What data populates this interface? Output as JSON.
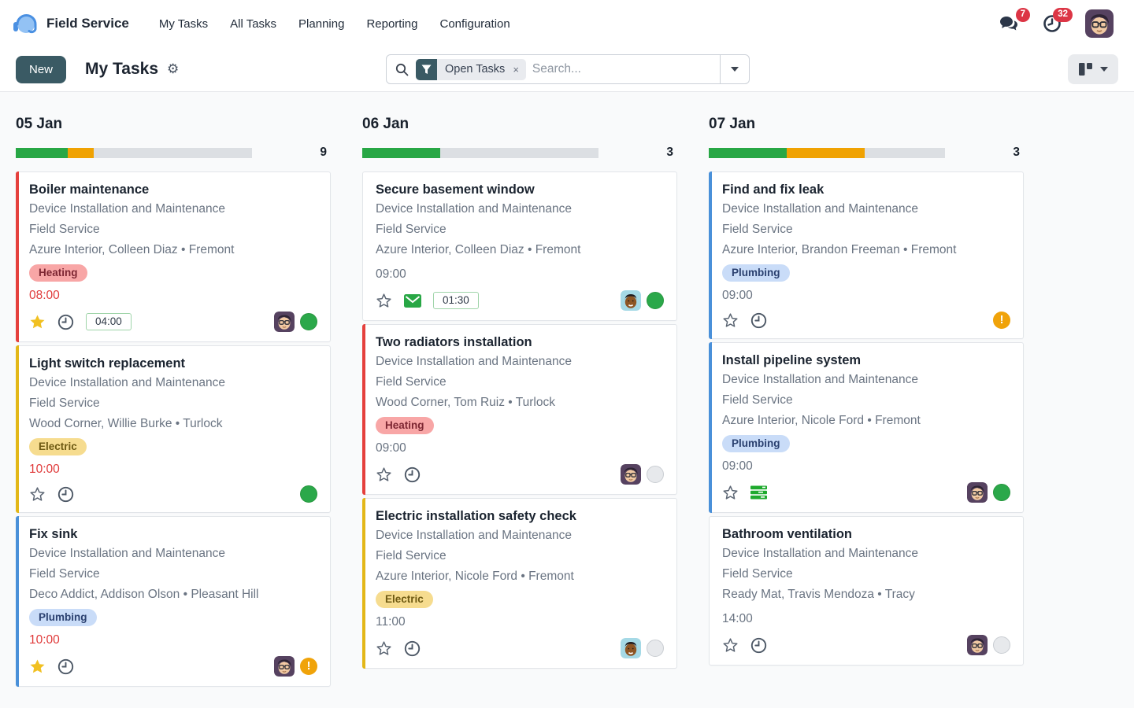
{
  "nav": {
    "app_name": "Field Service",
    "items": [
      "My Tasks",
      "All Tasks",
      "Planning",
      "Reporting",
      "Configuration"
    ],
    "messages_badge": "7",
    "activities_badge": "32"
  },
  "control": {
    "new_button": "New",
    "title": "My Tasks",
    "filter_facet": "Open Tasks",
    "facet_remove": "×",
    "search_placeholder": "Search..."
  },
  "colors": {
    "primary": "#3a5a64",
    "success": "#28a745",
    "warning": "#f0a202",
    "danger": "#dc3545",
    "stripe_red": "#e5403d",
    "stripe_yellow": "#e3b718",
    "stripe_blue": "#4a90d9"
  },
  "board": {
    "columns": [
      {
        "date": "05 Jan",
        "count": "9",
        "progress": {
          "green_pct": 22,
          "orange_pct": 11
        },
        "cards": [
          {
            "title": "Boiler maintenance",
            "project": "Device Installation and Maintenance",
            "subproject": "Field Service",
            "customer": "Azure Interior, Colleen Diaz • Fremont",
            "tag": {
              "label": "Heating",
              "color": "red"
            },
            "time": "08:00",
            "overdue": true,
            "stripe": "red",
            "star": "filled",
            "icon": "clock",
            "timer": "04:00",
            "avatar": "glasses",
            "status": "green"
          },
          {
            "title": "Light switch replacement",
            "project": "Device Installation and Maintenance",
            "subproject": "Field Service",
            "customer": "Wood Corner, Willie Burke • Turlock",
            "tag": {
              "label": "Electric",
              "color": "yellow"
            },
            "time": "10:00",
            "overdue": true,
            "stripe": "yellow",
            "star": "outline",
            "icon": "clock",
            "timer": null,
            "avatar": null,
            "status": "green"
          },
          {
            "title": "Fix sink",
            "project": "Device Installation and Maintenance",
            "subproject": "Field Service",
            "customer": "Deco Addict, Addison Olson • Pleasant Hill",
            "tag": {
              "label": "Plumbing",
              "color": "blue"
            },
            "time": "10:00",
            "overdue": true,
            "stripe": "blue",
            "star": "filled",
            "icon": "clock",
            "timer": null,
            "avatar": "glasses",
            "status": "warning"
          }
        ]
      },
      {
        "date": "06 Jan",
        "count": "3",
        "progress": {
          "green_pct": 33,
          "orange_pct": 0
        },
        "cards": [
          {
            "title": "Secure basement window",
            "project": "Device Installation and Maintenance",
            "subproject": "Field Service",
            "customer": "Azure Interior, Colleen Diaz • Fremont",
            "tag": null,
            "time": "09:00",
            "overdue": false,
            "stripe": null,
            "star": "outline",
            "icon": "envelope",
            "timer": "01:30",
            "avatar": "dark",
            "status": "green"
          },
          {
            "title": "Two radiators installation",
            "project": "Device Installation and Maintenance",
            "subproject": "Field Service",
            "customer": "Wood Corner, Tom Ruiz • Turlock",
            "tag": {
              "label": "Heating",
              "color": "red"
            },
            "time": "09:00",
            "overdue": false,
            "stripe": "red",
            "star": "outline",
            "icon": "clock",
            "timer": null,
            "avatar": "glasses",
            "status": "gray"
          },
          {
            "title": "Electric installation safety check",
            "project": "Device Installation and Maintenance",
            "subproject": "Field Service",
            "customer": "Azure Interior, Nicole Ford • Fremont",
            "tag": {
              "label": "Electric",
              "color": "yellow"
            },
            "time": "11:00",
            "overdue": false,
            "stripe": "yellow",
            "star": "outline",
            "icon": "clock",
            "timer": null,
            "avatar": "dark",
            "status": "gray"
          }
        ]
      },
      {
        "date": "07 Jan",
        "count": "3",
        "progress": {
          "green_pct": 33,
          "orange_pct": 33
        },
        "cards": [
          {
            "title": "Find and fix leak",
            "project": "Device Installation and Maintenance",
            "subproject": "Field Service",
            "customer": "Azure Interior, Brandon Freeman • Fremont",
            "tag": {
              "label": "Plumbing",
              "color": "blue"
            },
            "time": "09:00",
            "overdue": false,
            "stripe": "blue",
            "star": "outline",
            "icon": "clock",
            "timer": null,
            "avatar": null,
            "status": "warning"
          },
          {
            "title": "Install pipeline system",
            "project": "Device Installation and Maintenance",
            "subproject": "Field Service",
            "customer": "Azure Interior, Nicole Ford • Fremont",
            "tag": {
              "label": "Plumbing",
              "color": "blue"
            },
            "time": "09:00",
            "overdue": false,
            "stripe": "blue",
            "star": "outline",
            "icon": "bars",
            "timer": null,
            "avatar": "glasses",
            "status": "green"
          },
          {
            "title": "Bathroom ventilation",
            "project": "Device Installation and Maintenance",
            "subproject": "Field Service",
            "customer": "Ready Mat, Travis Mendoza • Tracy",
            "tag": null,
            "time": "14:00",
            "overdue": false,
            "stripe": null,
            "star": "outline",
            "icon": "clock",
            "timer": null,
            "avatar": "glasses",
            "status": "gray"
          }
        ]
      }
    ]
  }
}
